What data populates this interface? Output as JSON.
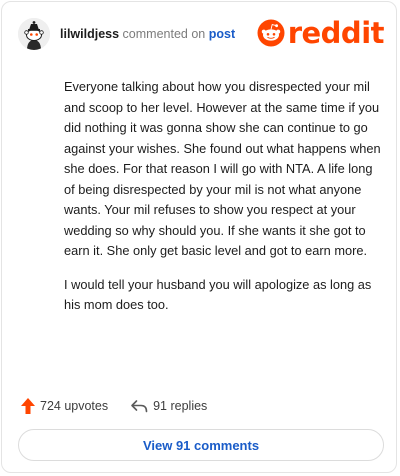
{
  "comment": {
    "username": "lilwildjess",
    "commented_on_text": "commented on",
    "post_link_text": "post",
    "paragraphs": [
      "Everyone talking about how you disrespected your mil and scoop to her level. However at the same time if you did nothing it was gonna show she can continue to go against your wishes. She found out what happens when she does. For that reason I will go with NTA. A life long of being disrespected by your mil is not what anyone wants. Your mil refuses to show you respect at your wedding so why should you. If she wants it she got to earn it. She only get basic level and got to earn more.",
      "I would tell your husband you will apologize as long as his mom does too."
    ]
  },
  "branding": {
    "logo_text": "reddit",
    "accent_color": "#ff4500",
    "link_color": "#1a5cc8"
  },
  "actions": {
    "upvotes_label": "724 upvotes",
    "replies_label": "91 replies",
    "upvote_icon": "upvote-arrow-icon",
    "reply_icon": "reply-arrow-icon"
  },
  "footer": {
    "view_comments_label": "View 91 comments"
  }
}
